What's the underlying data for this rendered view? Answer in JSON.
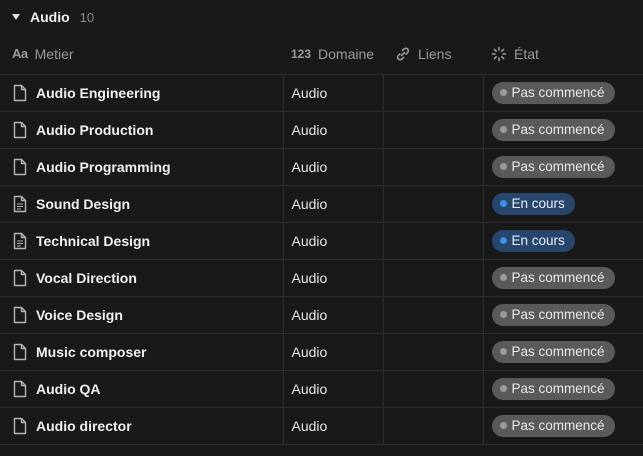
{
  "group": {
    "title": "Audio",
    "count": "10"
  },
  "columns": {
    "metier": {
      "label": "Metier",
      "icon": "text-property-icon"
    },
    "domaine": {
      "label": "Domaine",
      "icon": "number-property-icon",
      "glyph": "123"
    },
    "liens": {
      "label": "Liens",
      "icon": "link-icon"
    },
    "etat": {
      "label": "État",
      "icon": "status-icon"
    }
  },
  "status_colors": {
    "not_started": "#5a5a5a",
    "in_progress": "#28456c",
    "in_progress_dot": "#3e8fe5"
  },
  "rows": [
    {
      "metier": "Audio Engineering",
      "domaine": "Audio",
      "liens": "",
      "etat": "Pas commencé",
      "icon": "page-icon"
    },
    {
      "metier": "Audio Production",
      "domaine": "Audio",
      "liens": "",
      "etat": "Pas commencé",
      "icon": "page-icon"
    },
    {
      "metier": "Audio Programming",
      "domaine": "Audio",
      "liens": "",
      "etat": "Pas commencé",
      "icon": "page-icon"
    },
    {
      "metier": "Sound Design",
      "domaine": "Audio",
      "liens": "",
      "etat": "En cours",
      "icon": "document-icon"
    },
    {
      "metier": "Technical Design",
      "domaine": "Audio",
      "liens": "",
      "etat": "En cours",
      "icon": "document-icon"
    },
    {
      "metier": "Vocal Direction",
      "domaine": "Audio",
      "liens": "",
      "etat": "Pas commencé",
      "icon": "page-icon"
    },
    {
      "metier": "Voice Design",
      "domaine": "Audio",
      "liens": "",
      "etat": "Pas commencé",
      "icon": "page-icon"
    },
    {
      "metier": "Music composer",
      "domaine": "Audio",
      "liens": "",
      "etat": "Pas commencé",
      "icon": "page-icon"
    },
    {
      "metier": "Audio QA",
      "domaine": "Audio",
      "liens": "",
      "etat": "Pas commencé",
      "icon": "page-icon"
    },
    {
      "metier": "Audio director",
      "domaine": "Audio",
      "liens": "",
      "etat": "Pas commencé",
      "icon": "page-icon"
    }
  ]
}
